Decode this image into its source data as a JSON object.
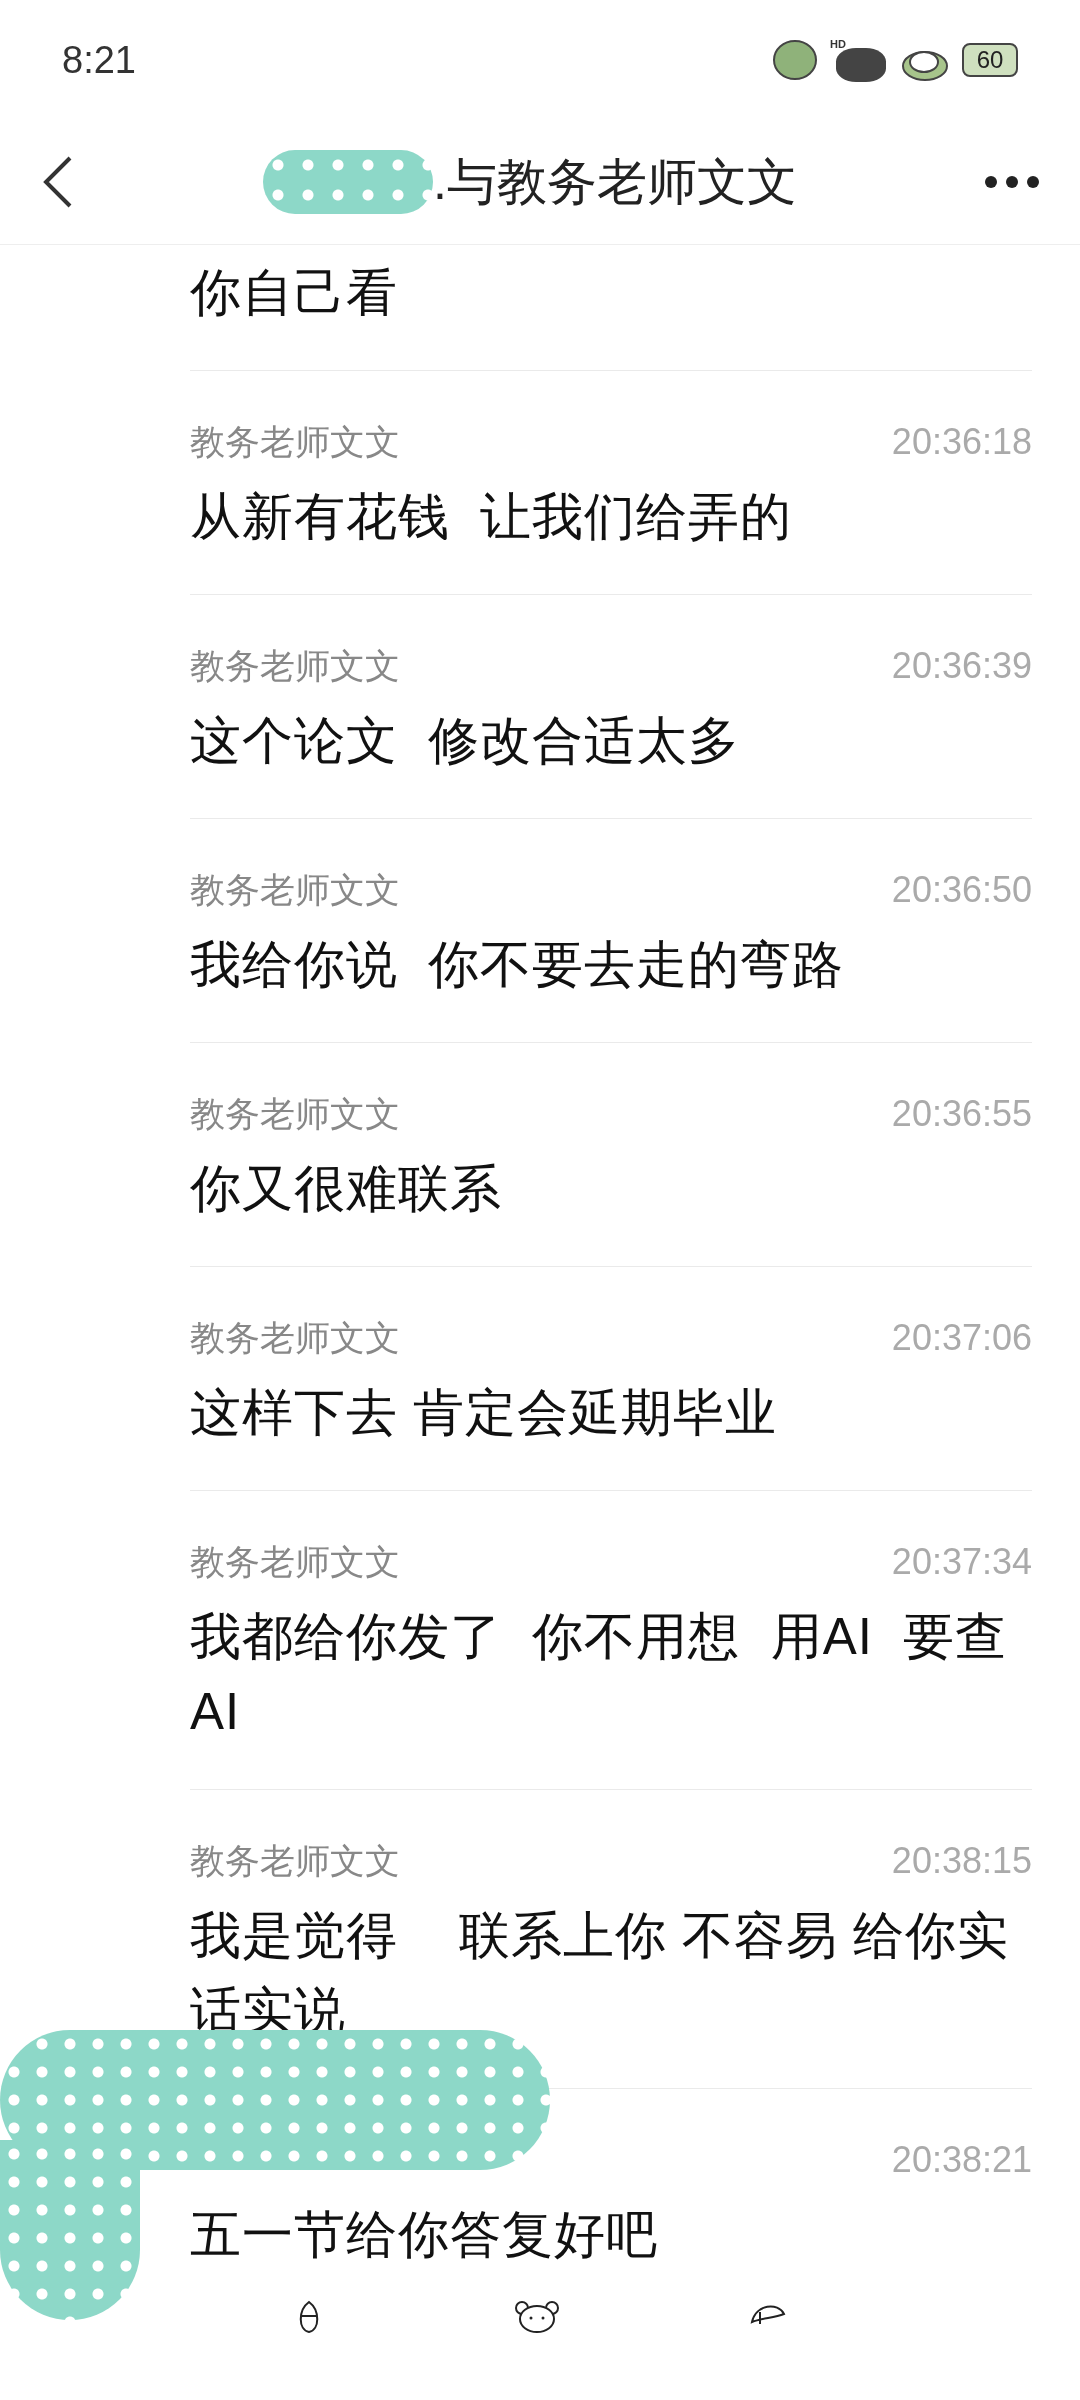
{
  "status_bar": {
    "time": "8:21",
    "hd_label": "HD",
    "battery": "60"
  },
  "header": {
    "title": ".与教务老师文文"
  },
  "messages": [
    {
      "text": "你自己看"
    },
    {
      "sender": "教务老师文文",
      "time": "20:36:18",
      "text": "从新有花钱  让我们给弄的"
    },
    {
      "sender": "教务老师文文",
      "time": "20:36:39",
      "text": "这个论文  修改合适太多"
    },
    {
      "sender": "教务老师文文",
      "time": "20:36:50",
      "text": "我给你说  你不要去走的弯路"
    },
    {
      "sender": "教务老师文文",
      "time": "20:36:55",
      "text": "你又很难联系"
    },
    {
      "sender": "教务老师文文",
      "time": "20:37:06",
      "text": "这样下去 肯定会延期毕业"
    },
    {
      "sender": "教务老师文文",
      "time": "20:37:34",
      "text": "我都给你发了  你不用想  用AI  要查AI"
    },
    {
      "sender": "教务老师文文",
      "time": "20:38:15",
      "text": "我是觉得    联系上你 不容易 给你实话实说"
    },
    {
      "time": "20:38:21",
      "text": "五一节给你答复好吧"
    }
  ]
}
